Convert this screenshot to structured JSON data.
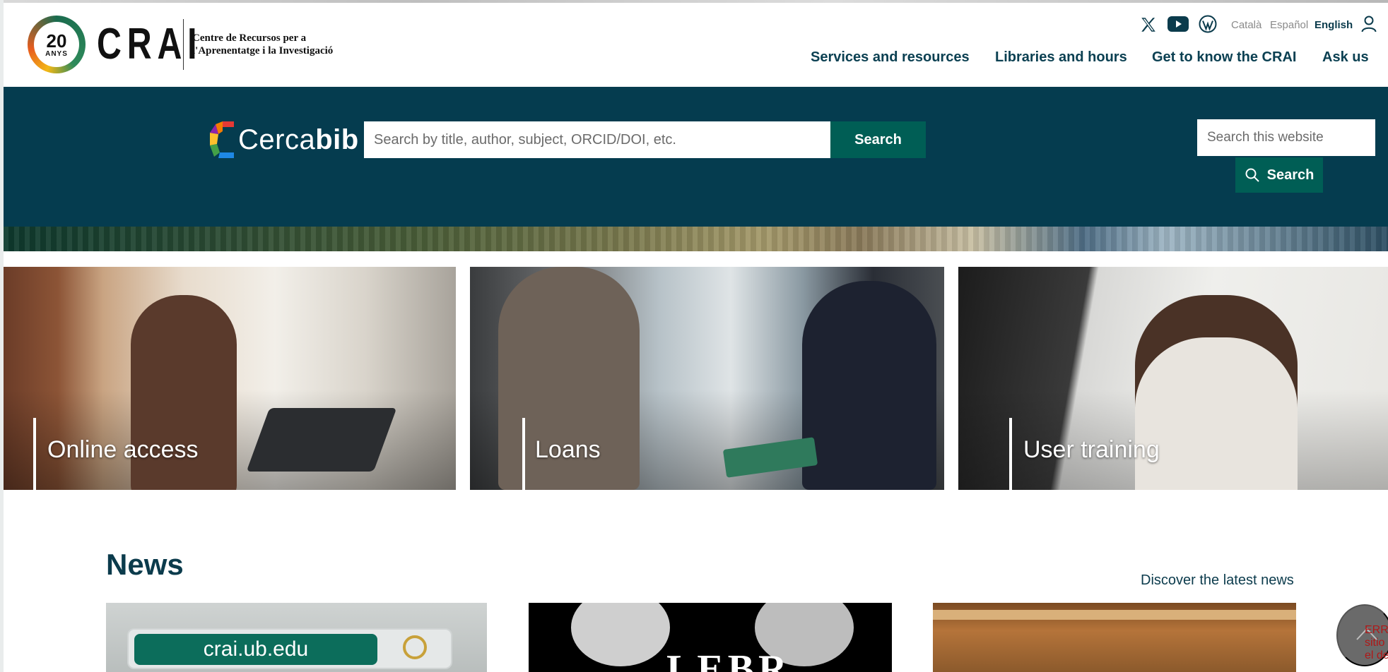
{
  "header": {
    "logo": {
      "badge_number": "20",
      "badge_text": "ANYS",
      "wordmark": "CRAI",
      "subtitle_line1": "Centre de Recursos per a",
      "subtitle_line2": "l'Aprenentatge i la Investigació"
    },
    "social_icons": [
      "x-icon",
      "youtube-icon",
      "wordpress-icon"
    ],
    "languages": [
      "Català",
      "Español",
      "English"
    ],
    "active_language": "English",
    "nav": [
      "Services and resources",
      "Libraries and hours",
      "Get to know the CRAI",
      "Ask us"
    ]
  },
  "search": {
    "brand_light": "Cerca",
    "brand_bold": "bib",
    "catalog_placeholder": "Search by title, author, subject, ORCID/DOI, etc.",
    "catalog_button": "Search",
    "site_placeholder": "Search this website",
    "site_button": "Search"
  },
  "cards": [
    {
      "label": "Online access"
    },
    {
      "label": "Loans"
    },
    {
      "label": "User training"
    }
  ],
  "news": {
    "title": "News",
    "link": "Discover the latest news",
    "card1_url_text": "crai.ub.edu",
    "card2_text": "LEBR"
  },
  "overlay": {
    "error_text_lines": [
      "ERR",
      "sitio",
      "el de"
    ]
  },
  "colors": {
    "brand_dark_teal": "#053c4f",
    "button_green": "#005e55",
    "nav_text": "#0b4052"
  }
}
